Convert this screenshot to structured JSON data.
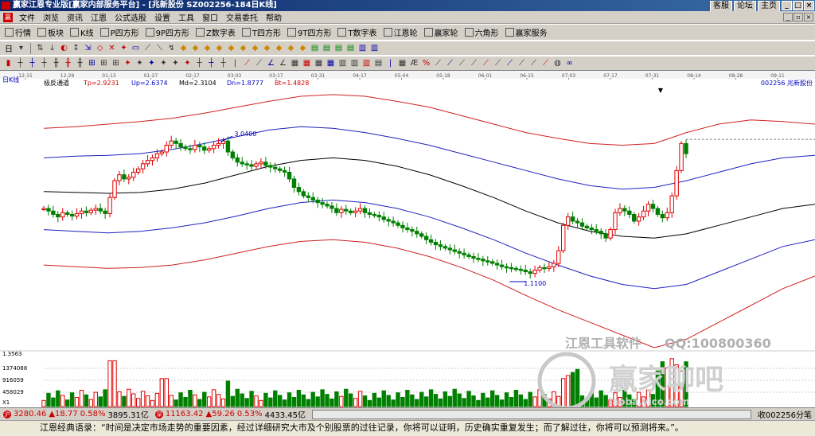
{
  "window": {
    "title": "赢家江恩专业版[赢家内部服务平台] - [兆新股份   SZ002256-184日K线]",
    "links": [
      "客服",
      "论坛",
      "主页"
    ]
  },
  "menu": [
    "文件",
    "浏览",
    "资讯",
    "江恩",
    "公式选股",
    "设置",
    "工具",
    "窗口",
    "交易委托",
    "帮助"
  ],
  "toolbar1": [
    {
      "icon": "grid-icon",
      "label": "行情"
    },
    {
      "icon": "blocks-icon",
      "label": "板块"
    },
    {
      "icon": "candles-icon",
      "label": "K线"
    },
    {
      "icon": "p-square-icon",
      "label": "P四方形"
    },
    {
      "icon": "9p-square-icon",
      "label": "9P四方形"
    },
    {
      "icon": "z-table-icon",
      "label": "Z数字表"
    },
    {
      "icon": "t-square-icon",
      "label": "T四方形"
    },
    {
      "icon": "9t-square-icon",
      "label": "9T四方形"
    },
    {
      "icon": "tn-table-icon",
      "label": "T数字表"
    },
    {
      "icon": "gann-wheel-icon",
      "label": "江恩轮"
    },
    {
      "icon": "winner-wheel-icon",
      "label": "赢家轮"
    },
    {
      "icon": "hexagon-icon",
      "label": "六角形"
    },
    {
      "icon": "service-icon",
      "label": "赢家服务"
    }
  ],
  "toolbar2": {
    "period_label": "日"
  },
  "chart_data": {
    "type": "candlestick",
    "panel_label": "日K线",
    "indicator_name": "极反通道",
    "indicator_values": [
      {
        "label": "Tp",
        "value": "2.9231"
      },
      {
        "label": "Up",
        "value": "2.6374"
      },
      {
        "label": "Md",
        "value": "2.3104"
      },
      {
        "label": "Dn",
        "value": "1.8777"
      },
      {
        "label": "Bt",
        "value": "1.4828"
      }
    ],
    "stock_label": "002256 兆新股份",
    "date_ticks": [
      "12-15",
      "12-29",
      "01-13",
      "01-27",
      "02-17",
      "03-03",
      "03-17",
      "03-31",
      "04-17",
      "05-04",
      "05-18",
      "06-01",
      "06-15",
      "07-03",
      "07-17",
      "07-31",
      "08-14",
      "08-28",
      "09-11"
    ],
    "annotations": [
      {
        "text": "3.0400",
        "type": "high"
      },
      {
        "text": "1.1100",
        "type": "low"
      }
    ],
    "last_close_dashed": true,
    "volume_axis_labels": [
      "1.3563",
      "1374088",
      "916059",
      "458029",
      "X1"
    ],
    "closes": [
      1.95,
      1.92,
      1.88,
      1.85,
      1.9,
      1.88,
      1.86,
      1.89,
      1.92,
      1.9,
      1.93,
      1.95,
      1.92,
      1.89,
      2.08,
      2.28,
      2.35,
      2.3,
      2.32,
      2.38,
      2.42,
      2.48,
      2.52,
      2.55,
      2.6,
      2.62,
      2.7,
      2.75,
      2.72,
      2.68,
      2.66,
      2.65,
      2.7,
      2.68,
      2.64,
      2.66,
      2.7,
      2.72,
      2.75,
      2.62,
      2.55,
      2.5,
      2.48,
      2.47,
      2.45,
      2.48,
      2.5,
      2.46,
      2.44,
      2.42,
      2.4,
      2.38,
      2.3,
      2.2,
      2.15,
      2.1,
      2.08,
      2.05,
      2.02,
      2.0,
      1.98,
      1.95,
      1.9,
      1.94,
      1.92,
      1.9,
      1.92,
      1.95,
      1.9,
      1.88,
      1.87,
      1.85,
      1.82,
      1.8,
      1.78,
      1.75,
      1.72,
      1.7,
      1.68,
      1.65,
      1.62,
      1.58,
      1.55,
      1.52,
      1.5,
      1.48,
      1.46,
      1.44,
      1.42,
      1.4,
      1.38,
      1.36,
      1.35,
      1.33,
      1.32,
      1.3,
      1.28,
      1.26,
      1.25,
      1.24,
      1.23,
      1.22,
      1.2,
      1.18,
      1.22,
      1.25,
      1.24,
      1.26,
      1.3,
      1.45,
      1.75,
      1.85,
      1.8,
      1.78,
      1.74,
      1.72,
      1.7,
      1.68,
      1.65,
      1.6,
      1.7,
      1.9,
      1.95,
      1.92,
      1.88,
      1.8,
      1.85,
      1.92,
      2.0,
      1.95,
      1.88,
      1.84,
      1.9,
      2.1,
      2.4,
      2.72,
      2.6
    ],
    "bands": {
      "top": [
        2.9,
        2.92,
        2.95,
        2.98,
        3.02,
        3.08,
        3.15,
        3.22,
        3.28,
        3.3,
        3.28,
        3.22,
        3.15,
        3.05,
        2.95,
        2.85,
        2.78,
        2.72,
        2.7,
        2.72,
        2.85,
        2.95,
        3.0,
        2.98,
        2.95
      ],
      "upper": [
        2.55,
        2.57,
        2.58,
        2.6,
        2.65,
        2.72,
        2.8,
        2.88,
        2.92,
        2.9,
        2.85,
        2.78,
        2.7,
        2.6,
        2.5,
        2.4,
        2.3,
        2.22,
        2.18,
        2.2,
        2.28,
        2.38,
        2.48,
        2.55,
        2.58
      ],
      "middle": [
        2.15,
        2.14,
        2.13,
        2.14,
        2.18,
        2.25,
        2.35,
        2.45,
        2.52,
        2.55,
        2.52,
        2.45,
        2.35,
        2.22,
        2.08,
        1.92,
        1.78,
        1.68,
        1.62,
        1.6,
        1.65,
        1.75,
        1.85,
        1.95,
        2.0
      ],
      "lower": [
        1.7,
        1.68,
        1.66,
        1.68,
        1.72,
        1.78,
        1.86,
        1.95,
        2.02,
        2.05,
        2.02,
        1.95,
        1.85,
        1.72,
        1.58,
        1.42,
        1.28,
        1.15,
        1.05,
        1.0,
        1.05,
        1.2,
        1.35,
        1.5,
        1.58
      ],
      "bottom": [
        1.28,
        1.26,
        1.24,
        1.25,
        1.28,
        1.34,
        1.42,
        1.5,
        1.56,
        1.58,
        1.55,
        1.48,
        1.38,
        1.25,
        1.1,
        0.92,
        0.75,
        0.6,
        0.45,
        0.3,
        0.4,
        0.6,
        0.8,
        1.0,
        1.15
      ]
    },
    "ylim": [
      0.3,
      3.45
    ]
  },
  "watermark": {
    "line1": "江恩工具软件",
    "line2": "QQ:100800360",
    "logo": "赢家聊吧",
    "url": "laoba.yico.com"
  },
  "status": {
    "sh_index": "3280.46",
    "sh_change": "▲18.77",
    "sh_pct": "0.58%",
    "sh_amount": "3895.31亿",
    "sz_index": "11163.42",
    "sz_change": "▲59.26",
    "sz_pct": "0.53%",
    "sz_amount": "4433.45亿",
    "right_text": "收002256分笔"
  },
  "quote": "江恩经典语录：“时间是决定市场走势的重要因素，经过详细研究大市及个别股票的过往记录，你将可以证明，历史确实重复发生；而了解过往，你将可以预测将来。”。",
  "colors": {
    "up": "#e00000",
    "down": "#008000",
    "band_outer": "#d02020",
    "band_inner": "#2020c0",
    "band_mid": "#000000"
  }
}
